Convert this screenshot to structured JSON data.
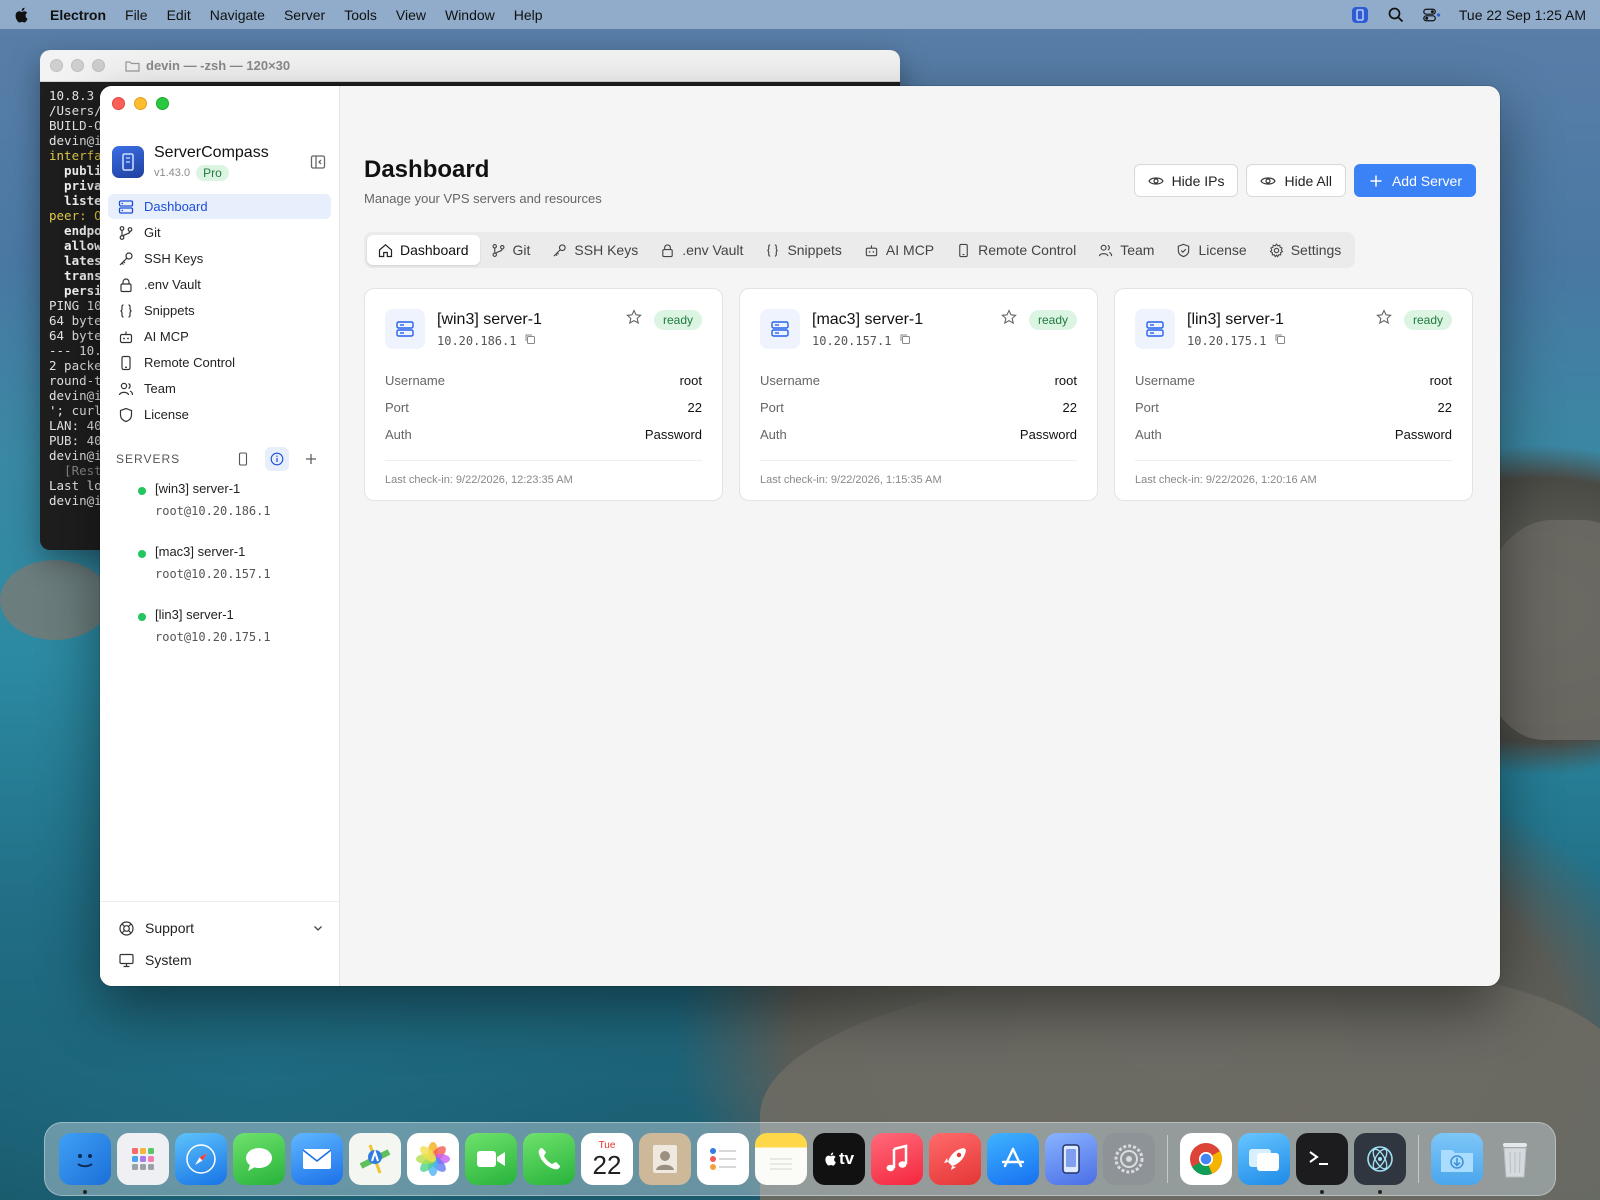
{
  "menubar": {
    "app_name": "Electron",
    "menus": [
      "File",
      "Edit",
      "Navigate",
      "Server",
      "Tools",
      "View",
      "Window",
      "Help"
    ],
    "clock": "Tue 22 Sep  1:25 AM"
  },
  "terminal": {
    "title": "devin — -zsh — 120×30",
    "lines": [
      "10.8.3",
      "/Users/",
      "BUILD-O",
      "devin@i",
      "interfa",
      "  publi",
      "  priva",
      "  liste",
      "",
      "peer: O",
      "  endpo",
      "  allow",
      "  lates",
      "  trans",
      "  persi",
      "PING 10",
      "64 byte",
      "64 byte",
      "",
      "--- 10.",
      "2 packe",
      "round-t",
      "devin@i",
      "'; curl",
      "LAN: 40",
      "PUB: 40",
      "devin@i",
      "  [Rest",
      "Last lo",
      "devin@i"
    ]
  },
  "app": {
    "name": "ServerCompass",
    "version": "v1.43.0",
    "plan": "Pro",
    "nav": [
      {
        "label": "Dashboard",
        "icon": "server-stack-icon"
      },
      {
        "label": "Git",
        "icon": "git-branch-icon"
      },
      {
        "label": "SSH Keys",
        "icon": "key-icon"
      },
      {
        "label": ".env Vault",
        "icon": "lock-icon"
      },
      {
        "label": "Snippets",
        "icon": "braces-icon"
      },
      {
        "label": "AI MCP",
        "icon": "robot-icon"
      },
      {
        "label": "Remote Control",
        "icon": "smartphone-icon"
      },
      {
        "label": "Team",
        "icon": "users-icon"
      },
      {
        "label": "License",
        "icon": "shield-icon"
      }
    ],
    "servers_heading": "SERVERS",
    "servers": [
      {
        "name": "[win3] server-1",
        "address": "root@10.20.186.1"
      },
      {
        "name": "[mac3] server-1",
        "address": "root@10.20.157.1"
      },
      {
        "name": "[lin3] server-1",
        "address": "root@10.20.175.1"
      }
    ],
    "footer": {
      "support": "Support",
      "system": "System"
    }
  },
  "main": {
    "title": "Dashboard",
    "subtitle": "Manage your VPS servers and resources",
    "actions": {
      "hide_ips": "Hide IPs",
      "hide_all": "Hide All",
      "add_server": "Add Server"
    },
    "tabs": [
      {
        "label": "Dashboard",
        "icon": "home-icon"
      },
      {
        "label": "Git",
        "icon": "git-branch-icon"
      },
      {
        "label": "SSH Keys",
        "icon": "key-icon"
      },
      {
        "label": ".env Vault",
        "icon": "lock-icon"
      },
      {
        "label": "Snippets",
        "icon": "braces-icon"
      },
      {
        "label": "AI MCP",
        "icon": "robot-icon"
      },
      {
        "label": "Remote Control",
        "icon": "smartphone-icon"
      },
      {
        "label": "Team",
        "icon": "users-icon"
      },
      {
        "label": "License",
        "icon": "shield-icon"
      },
      {
        "label": "Settings",
        "icon": "gear-icon"
      }
    ],
    "card_labels": {
      "username": "Username",
      "port": "Port",
      "auth": "Auth"
    },
    "cards": [
      {
        "title": "[win3] server-1",
        "ip": "10.20.186.1",
        "status": "ready",
        "username": "root",
        "port": "22",
        "auth": "Password",
        "checkin": "Last check-in: 9/22/2026, 12:23:35 AM"
      },
      {
        "title": "[mac3] server-1",
        "ip": "10.20.157.1",
        "status": "ready",
        "username": "root",
        "port": "22",
        "auth": "Password",
        "checkin": "Last check-in: 9/22/2026, 1:15:35 AM"
      },
      {
        "title": "[lin3] server-1",
        "ip": "10.20.175.1",
        "status": "ready",
        "username": "root",
        "port": "22",
        "auth": "Password",
        "checkin": "Last check-in: 9/22/2026, 1:20:16 AM"
      }
    ]
  },
  "dock": {
    "calendar_month": "Tue",
    "calendar_day": "22",
    "tv_label": "tv"
  },
  "colors": {
    "accent": "#3b82f6",
    "active_nav_bg": "#e7eefc",
    "status_green": "#22c55e",
    "ready_badge_bg": "#dcf5e3",
    "ready_badge_text": "#1f7a3d"
  }
}
